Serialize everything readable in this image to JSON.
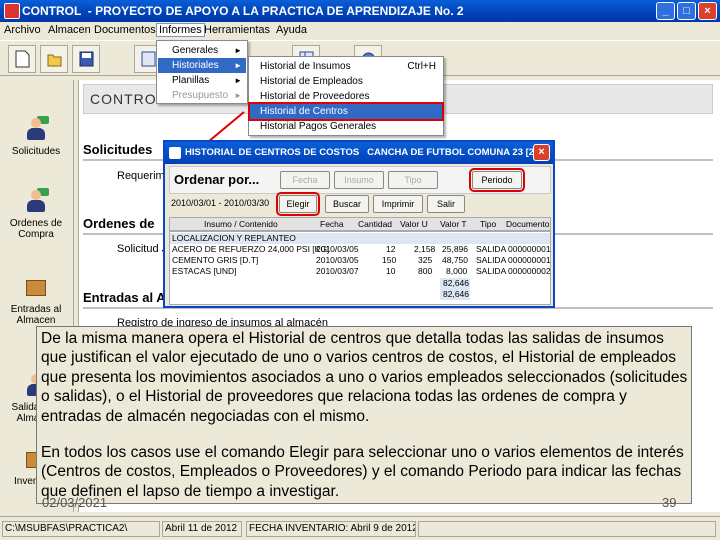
{
  "window": {
    "title": "CONTROL  - PROYECTO DE APOYO A LA PRACTICA DE APRENDIZAJE No. 2",
    "buttons": [
      "_",
      "□",
      "×"
    ]
  },
  "menubar": [
    "Archivo",
    "Almacen",
    "Documentos",
    "Informes",
    "Herramientas",
    "Ayuda"
  ],
  "toolbar": {
    "icons": [
      "new-document-icon",
      "open-folder-icon",
      "save-icon",
      "report-icon",
      "grid-icon",
      "help-icon"
    ]
  },
  "sidebar": [
    {
      "label": "Solicitudes",
      "icon": "person-icon"
    },
    {
      "label": "Ordenes de Compra",
      "icon": "person-icon"
    },
    {
      "label": "Entradas al Almacen",
      "icon": "box-icon"
    },
    {
      "label": "Salidas del Almacen",
      "icon": "person-icon"
    },
    {
      "label": "Inventario",
      "icon": "box-icon"
    }
  ],
  "main": {
    "header": "CONTROL -",
    "sections": [
      {
        "title": "Solicitudes",
        "sub": "Requerimi"
      },
      {
        "title": "Ordenes de",
        "sub": "Solicitud J"
      },
      {
        "title": "Entradas al A",
        "sub": "Registro de ingreso de insumos al almacén"
      }
    ]
  },
  "informes_menu": [
    {
      "label": "Generales",
      "state": "normal"
    },
    {
      "label": "Historiales",
      "state": "selected"
    },
    {
      "label": "Planillas",
      "state": "normal"
    },
    {
      "label": "Presupuesto",
      "state": "disabled"
    }
  ],
  "historiales_menu": [
    {
      "label": "Historial de Insumos",
      "shortcut": "Ctrl+H"
    },
    {
      "label": "Historial de Empleados",
      "shortcut": ""
    },
    {
      "label": "Historial de Proveedores",
      "shortcut": ""
    },
    {
      "label": "Historial de Centros",
      "shortcut": ""
    },
    {
      "label": "Historial Pagos Generales",
      "shortcut": ""
    }
  ],
  "dialog": {
    "title": "HISTORIAL DE CENTROS DE COSTOS   CANCHA DE FUTBOL COMUNA 23 [20...",
    "ordenar_label": "Ordenar por...",
    "sort_buttons": [
      "Fecha",
      "Insumo",
      "Tipo",
      "Periodo"
    ],
    "date_range": "2010/03/01 - 2010/03/30",
    "action_buttons": [
      "Elegir",
      "Buscar",
      "Imprimir",
      "Salir"
    ],
    "columns": [
      "Insumo / Contenido",
      "Fecha",
      "Cantidad",
      "Valor U",
      "Valor T",
      "Tipo",
      "Documento"
    ],
    "group_label": "LOCALIZACION Y REPLANTEO",
    "rows": [
      [
        "ACERO DE REFUERZO 24,000 PSI [KG]",
        "2010/03/05",
        "12",
        "2,158",
        "25,896",
        "SALIDA",
        "000000001"
      ],
      [
        "CEMENTO GRIS [D.T]",
        "2010/03/05",
        "150",
        "325",
        "48,750",
        "SALIDA",
        "000000001"
      ],
      [
        "ESTACAS [UND]",
        "2010/03/07",
        "10",
        "800",
        "8,000",
        "SALIDA",
        "000000002"
      ]
    ],
    "totals": [
      "82,646",
      "82,646"
    ]
  },
  "overlay": {
    "para1": "De la misma manera opera el Historial de centros que detalla todas las salidas de insumos que justifican el valor ejecutado de uno o varios centros de costos, el Historial de empleados que presenta los movimientos asociados a uno o varios empleados seleccionados (solicitudes o salidas), o el Historial de proveedores que relaciona todas las ordenes de compra y entradas de almacén negociadas con el mismo.",
    "para2": "En todos los casos use el comando Elegir para seleccionar uno o varios elementos de interés (Centros de costos, Empleados o Proveedores) y el comando Periodo para indicar las fechas que definen el lapso de tiempo a investigar.",
    "date": "02/03/2021",
    "page": "39"
  },
  "statusbar": [
    "C:\\MSUBFAS\\PRACTICA2\\",
    "Abril 11 de 2012",
    "FECHA INVENTARIO: Abril 9 de 2012"
  ],
  "colors": {
    "titlebar": "#0042b8",
    "highlight": "#316ac5",
    "callout": "#e00000"
  }
}
